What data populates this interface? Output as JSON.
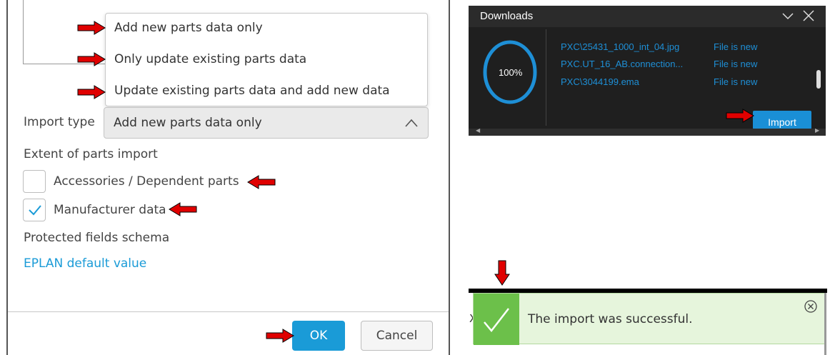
{
  "import_dialog": {
    "dropdown_options": [
      "Add new parts data only",
      "Only update existing parts data",
      "Update existing parts data and add new data"
    ],
    "import_type_label": "Import type",
    "import_type_value": "Add new parts data only",
    "extent_label": "Extent of parts import",
    "checkboxes": [
      {
        "label": "Accessories / Dependent parts",
        "checked": false
      },
      {
        "label": "Manufacturer data",
        "checked": true
      }
    ],
    "protected_fields_label": "Protected fields schema",
    "protected_fields_value": "EPLAN default value",
    "ok_label": "OK",
    "cancel_label": "Cancel"
  },
  "downloads": {
    "title": "Downloads",
    "progress": "100%",
    "files": [
      {
        "name": "PXC\\25431_1000_int_04.jpg",
        "status": "File is new"
      },
      {
        "name": "PXC.UT_16_AB.connection...",
        "status": "File is new"
      },
      {
        "name": "PXC\\3044199.ema",
        "status": "File is new"
      }
    ],
    "import_label": "Import"
  },
  "toast": {
    "message": "The import was successful.",
    "partial_text": "X"
  },
  "colors": {
    "accent": "#1a9bd7",
    "arrow": "#e00000",
    "toast_green": "#6cc04a"
  }
}
